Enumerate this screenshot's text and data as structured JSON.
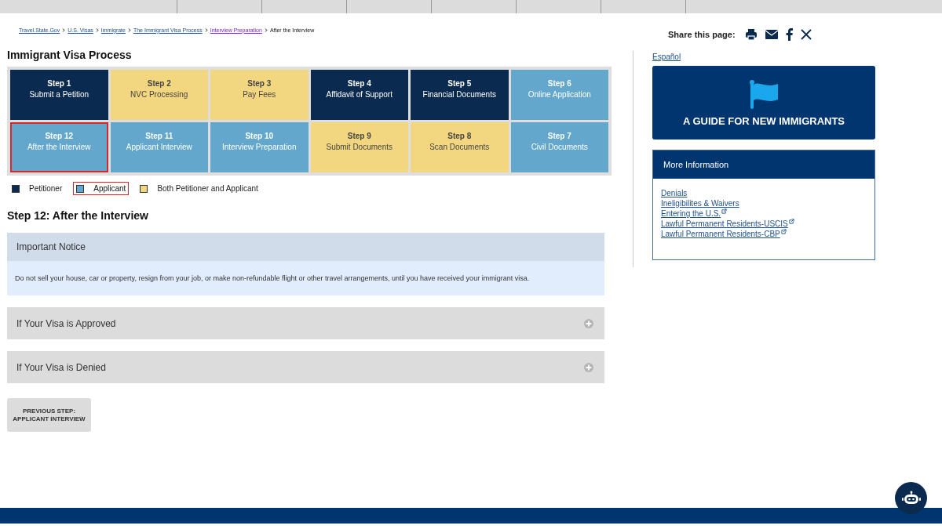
{
  "breadcrumb": [
    {
      "label": "Travel.State.Gov",
      "kind": "link"
    },
    {
      "label": "U.S. Visas",
      "kind": "link"
    },
    {
      "label": "Immigrate",
      "kind": "link"
    },
    {
      "label": "The Immigrant Visa Process",
      "kind": "link"
    },
    {
      "label": "Interview Preparation",
      "kind": "visited"
    },
    {
      "label": "After the Interview",
      "kind": "current"
    }
  ],
  "share": {
    "label": "Share this page:"
  },
  "title": "Immigrant Visa Process",
  "steps": [
    {
      "number": "Step 1",
      "label": "Submit a Petition",
      "kind": "petitioner",
      "selected": false
    },
    {
      "number": "Step 2",
      "label": "NVC Processing",
      "kind": "both",
      "selected": false
    },
    {
      "number": "Step 3",
      "label": "Pay Fees",
      "kind": "both",
      "selected": false
    },
    {
      "number": "Step 4",
      "label": "Affidavit of Support",
      "kind": "petitioner",
      "selected": false
    },
    {
      "number": "Step 5",
      "label": "Financial Documents",
      "kind": "petitioner",
      "selected": false
    },
    {
      "number": "Step 6",
      "label": "Online Application",
      "kind": "applicant",
      "selected": false
    },
    {
      "number": "Step 12",
      "label": "After the Interview",
      "kind": "applicant",
      "selected": true
    },
    {
      "number": "Step 11",
      "label": "Applicant Interview",
      "kind": "applicant",
      "selected": false
    },
    {
      "number": "Step 10",
      "label": "Interview Preparation",
      "kind": "applicant",
      "selected": false
    },
    {
      "number": "Step 9",
      "label": "Submit Documents",
      "kind": "both",
      "selected": false
    },
    {
      "number": "Step 8",
      "label": "Scan Documents",
      "kind": "both",
      "selected": false
    },
    {
      "number": "Step 7",
      "label": "Civil Documents",
      "kind": "applicant",
      "selected": false
    }
  ],
  "legend": [
    {
      "label": "Petitioner",
      "kind": "petitioner",
      "selected": false
    },
    {
      "label": "Applicant",
      "kind": "applicant",
      "selected": true
    },
    {
      "label": "Both Petitioner and Applicant",
      "kind": "both",
      "selected": false
    }
  ],
  "heading": "Step 12: After the Interview",
  "notice": {
    "title": "Important Notice",
    "text": "Do not sell your house, car or property, resign from your job, or make non-refundable flight or other travel arrangements, until you have received your immigrant visa."
  },
  "sections": [
    {
      "title": "If Your Visa is Approved",
      "expanded": false
    },
    {
      "title": "If Your Visa is Denied",
      "expanded": false
    }
  ],
  "previous_button": {
    "line1": "PREVIOUS STEP:",
    "line2": "APPLICANT INTERVIEW"
  },
  "sidebar": {
    "language_link": "Español",
    "guide_banner": "A GUIDE FOR NEW IMMIGRANTS",
    "more_info": {
      "title": "More Information",
      "links": [
        {
          "label": "Denials",
          "external": false
        },
        {
          "label": "Ineligibilites & Waivers",
          "external": false
        },
        {
          "label": "Entering the U.S.",
          "external": true
        },
        {
          "label": "Lawful Permanent Residents-USCIS",
          "external": true
        },
        {
          "label": "Lawful Permanent Residents-CBP",
          "external": true
        }
      ]
    }
  }
}
